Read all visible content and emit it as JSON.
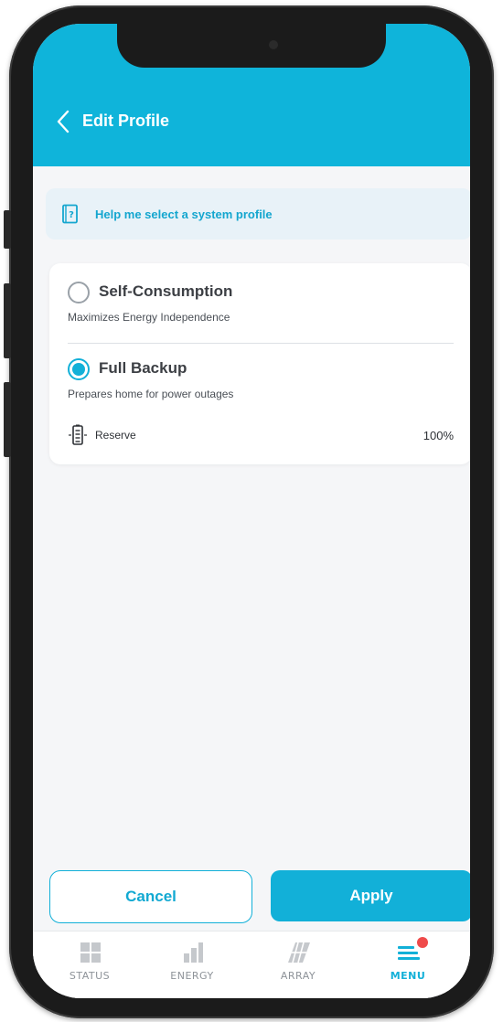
{
  "header": {
    "title": "Edit Profile"
  },
  "help_banner": {
    "text": "Help me select a system profile"
  },
  "profiles": [
    {
      "title": "Self-Consumption",
      "description": "Maximizes Energy Independence",
      "selected": false
    },
    {
      "title": "Full Backup",
      "description": "Prepares home for power outages",
      "selected": true
    }
  ],
  "reserve": {
    "label": "Reserve",
    "value": "100%"
  },
  "actions": {
    "cancel_label": "Cancel",
    "apply_label": "Apply"
  },
  "tabs": [
    {
      "label": "STATUS",
      "icon": "grid-icon",
      "active": false
    },
    {
      "label": "ENERGY",
      "icon": "bar-chart-icon",
      "active": false
    },
    {
      "label": "ARRAY",
      "icon": "solar-panel-icon",
      "active": false
    },
    {
      "label": "MENU",
      "icon": "menu-icon",
      "active": true,
      "badge": true
    }
  ],
  "colors": {
    "accent": "#12b0d8",
    "header": "#0fb4da",
    "badge": "#ef4b4b"
  }
}
